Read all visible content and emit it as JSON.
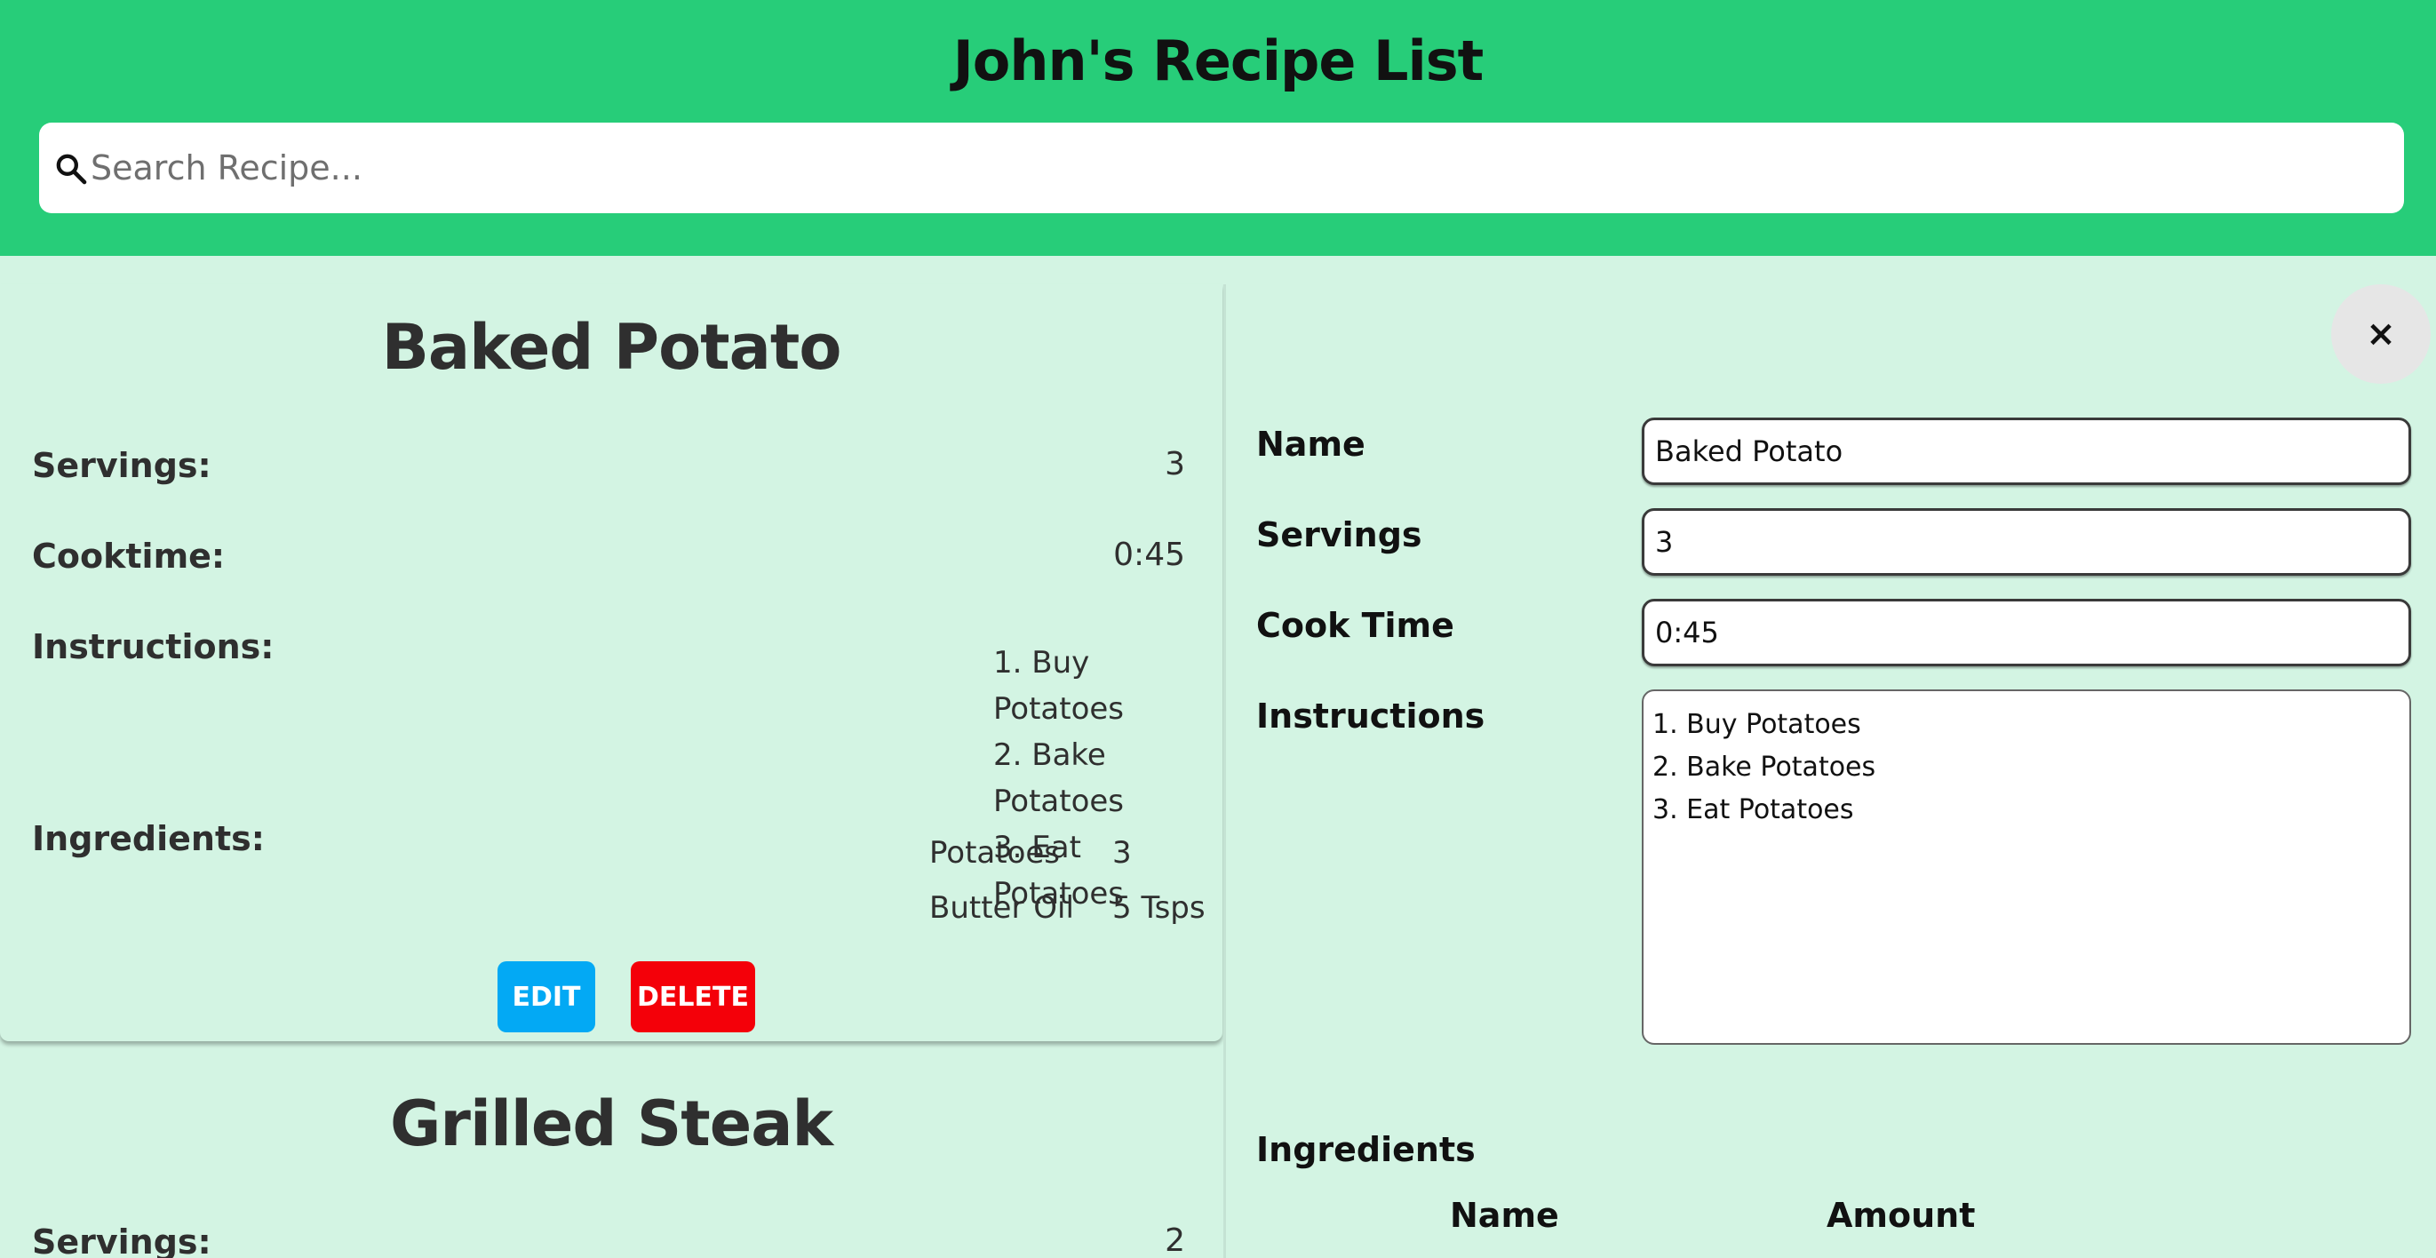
{
  "app": {
    "title": "John's Recipe List"
  },
  "search": {
    "placeholder": "Search Recipe..."
  },
  "icons": {
    "search": "search-icon",
    "close": "close-icon"
  },
  "colors": {
    "header": "#27cd79",
    "background": "#d3f4e3",
    "edit": "#03a9f4",
    "delete": "#f40009"
  },
  "recipes": [
    {
      "name": "Baked Potato",
      "servings_label": "Servings:",
      "servings": "3",
      "cooktime_label": "Cooktime:",
      "cooktime": "0:45",
      "instructions_label": "Instructions:",
      "instructions": [
        "1. Buy Potatoes",
        "2. Bake Potatoes",
        "3. Eat Potatoes"
      ],
      "ingredients_label": "Ingredients:",
      "ingredients": [
        {
          "name": "Potatoes",
          "amount": "3"
        },
        {
          "name": "Butter Oil",
          "amount": "5 Tsps"
        }
      ],
      "edit_label": "EDIT",
      "delete_label": "DELETE"
    },
    {
      "name": "Grilled Steak",
      "servings_label": "Servings:",
      "servings": "2"
    }
  ],
  "edit_form": {
    "close_label": "×",
    "name_label": "Name",
    "name_value": "Baked Potato",
    "servings_label": "Servings",
    "servings_value": "3",
    "cooktime_label": "Cook Time",
    "cooktime_value": "0:45",
    "instructions_label": "Instructions",
    "instructions_value": "1. Buy Potatoes\n2. Bake Potatoes\n3. Eat Potatoes",
    "ingredients_label": "Ingredients",
    "ingredients_columns": [
      "Name",
      "Amount"
    ]
  }
}
